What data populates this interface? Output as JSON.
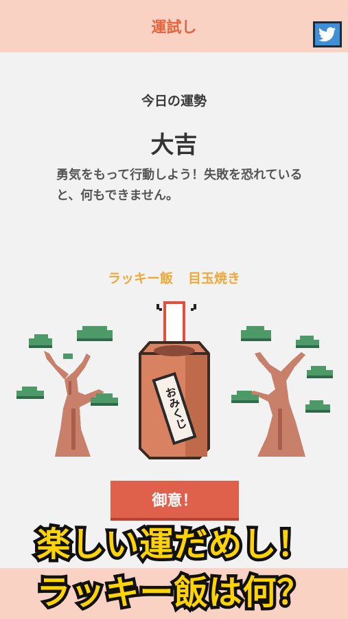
{
  "header": {
    "title": "運試し",
    "share_icon": "twitter-bird-icon"
  },
  "fortune": {
    "label": "今日の運勢",
    "result": "大吉",
    "message": "勇気をもって行動しよう！失敗を恐れていると、何もできません。"
  },
  "lucky": {
    "label": "ラッキー飯",
    "food": "目玉焼き"
  },
  "illustration": {
    "box_label": "おみくじ",
    "stick_color": "#e74c3c"
  },
  "button": {
    "label": "御意！"
  },
  "promo": {
    "line1": "楽しい運だめし！",
    "line2": "ラッキー飯は何？"
  },
  "colors": {
    "accent": "#e8643c",
    "lucky": "#efa93a",
    "button": "#e0614b",
    "header_bg": "#fad2c4",
    "promo_text": "#ffd400"
  }
}
